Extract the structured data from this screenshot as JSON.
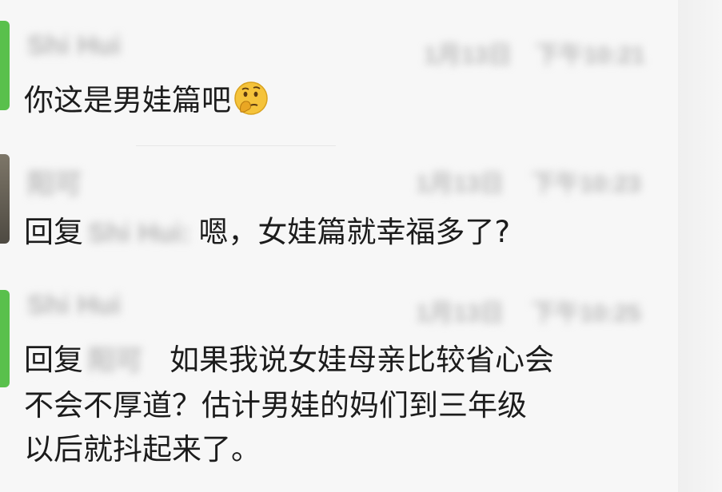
{
  "messages": [
    {
      "sender": "Shi Hui",
      "date": "1月13日",
      "time": "下午10:21",
      "text": "你这是男娃篇吧",
      "emoji": "thinking-face-emoji"
    },
    {
      "sender": "阳可",
      "date": "1月13日",
      "time": "下午10:23",
      "reply_prefix": "回复",
      "reply_to": "Shi Hui:",
      "text": "嗯，女娃篇就幸福多了?"
    },
    {
      "sender": "Shi Hui",
      "date": "1月13日",
      "time": "下午10:25",
      "reply_prefix": "回复",
      "reply_to": "阳可",
      "lines": [
        "如果我说女娃母亲比较省心会",
        "不会不厚道？估计男娃的妈们到三年级",
        "以后就抖起来了。"
      ]
    }
  ],
  "colors": {
    "background": "#f7f7f7",
    "text": "#1c1c1c",
    "blurred": "#b9b9b9",
    "avatar_green": "#59c04c"
  }
}
